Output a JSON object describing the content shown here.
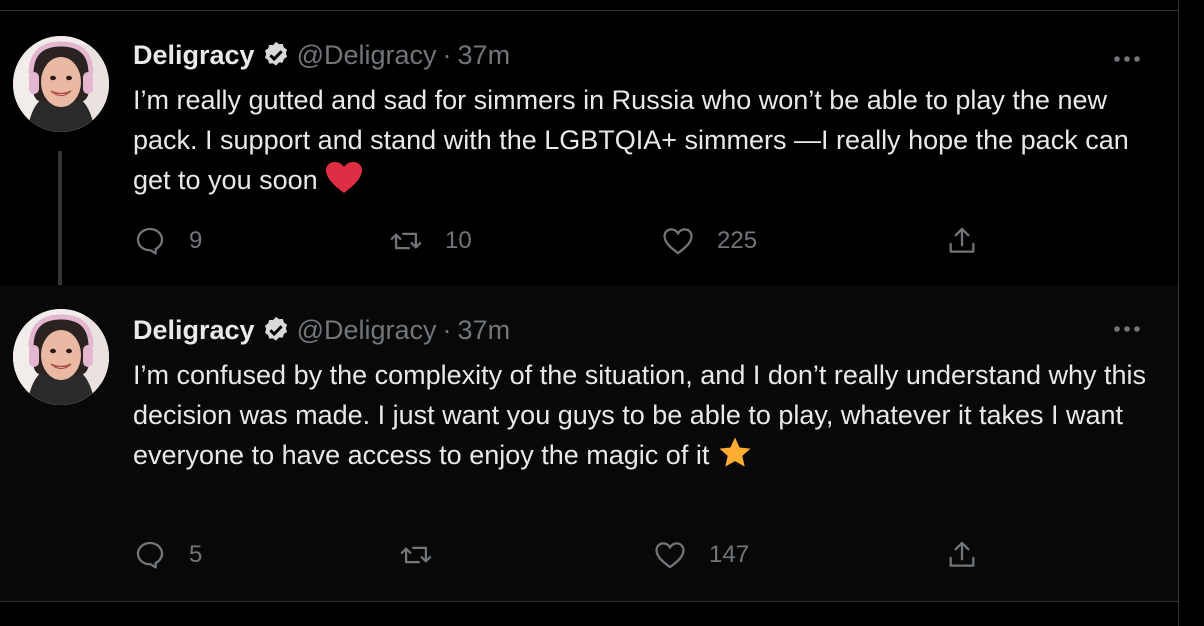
{
  "tweets": [
    {
      "name": "Deligracy",
      "handle": "@Deligracy",
      "dot": "·",
      "time": "37m",
      "text": "I’m really gutted and sad for simmers in Russia who won’t be able to play the new pack. I support and stand with the LGBTQIA+ simmers —I really hope the pack can get to you soon",
      "emoji": "heart-emoji",
      "replies": "9",
      "retweets": "10",
      "likes": "225"
    },
    {
      "name": "Deligracy",
      "handle": "@Deligracy",
      "dot": "·",
      "time": "37m",
      "text": "I’m confused by the complexity of the situation, and I don’t really understand why this decision was made. I just want you guys to be able to play, whatever it takes I want everyone to have access to enjoy the magic of it",
      "emoji": "star-emoji",
      "replies": "5",
      "retweets": "",
      "likes": "147"
    }
  ],
  "colors": {
    "background": "#000000",
    "text": "#e7e9ea",
    "muted": "#71767b",
    "heart": "#e0245e",
    "star": "#ffac33"
  }
}
